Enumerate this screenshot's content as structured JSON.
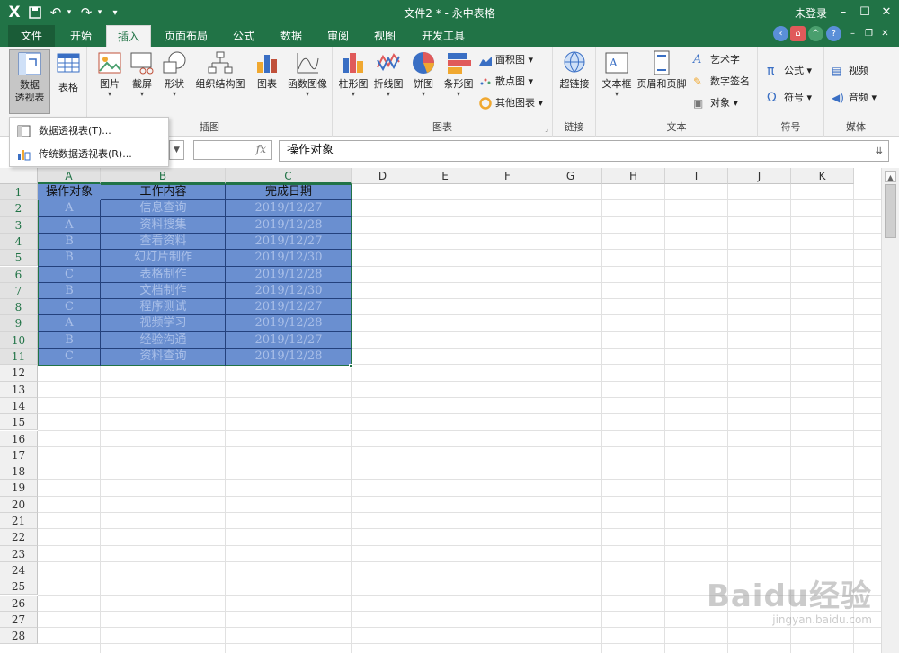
{
  "titlebar": {
    "app_logo": "X",
    "save_icon": "save-icon",
    "undo_icon": "↶",
    "redo_icon": "↷",
    "customize_icon": "▾",
    "title": "文件2 * - 永中表格",
    "login": "未登录",
    "minimize": "–",
    "maximize": "☐",
    "close": "✕"
  },
  "tabs": [
    {
      "label": "文件"
    },
    {
      "label": "开始"
    },
    {
      "label": "插入"
    },
    {
      "label": "页面布局"
    },
    {
      "label": "公式"
    },
    {
      "label": "数据"
    },
    {
      "label": "审阅"
    },
    {
      "label": "视图"
    },
    {
      "label": "开发工具"
    }
  ],
  "active_tab": "插入",
  "ribbon": {
    "pivot_label_1": "数据",
    "pivot_label_2": "透视表",
    "table": "表格",
    "picture": "图片",
    "screenshot": "截屏",
    "shape": "形状",
    "org_chart": "组织结构图",
    "chart": "图表",
    "function_chart": "函数图像",
    "illustrations_group": "插图",
    "column_chart": "柱形图",
    "line_chart": "折线图",
    "pie_chart": "饼图",
    "bar_chart": "条形图",
    "area_chart": "面积图",
    "scatter_chart": "散点图",
    "other_chart": "其他图表",
    "charts_group": "图表",
    "hyperlink": "超链接",
    "links_group": "链接",
    "textbox": "文本框",
    "header_footer": "页眉和页脚",
    "wordart": "艺术字",
    "signature": "数字签名",
    "object": "对象",
    "text_group": "文本",
    "formula": "公式",
    "symbol": "符号",
    "symbols_group": "符号",
    "video": "视频",
    "audio": "音频",
    "media_group": "媒体"
  },
  "menu": {
    "item1": "数据透视表(T)...",
    "item2": "传统数据透视表(R)..."
  },
  "formula_bar": {
    "fx": "fx",
    "content": "操作对象"
  },
  "columns": [
    "A",
    "B",
    "C",
    "D",
    "E",
    "F",
    "G",
    "H",
    "I",
    "J",
    "K"
  ],
  "rows": [
    "1",
    "2",
    "3",
    "4",
    "5",
    "6",
    "7",
    "8",
    "9",
    "10",
    "11",
    "12",
    "13",
    "14",
    "15",
    "16",
    "17",
    "18",
    "19",
    "20",
    "21",
    "22",
    "23",
    "24",
    "25",
    "26",
    "27",
    "28"
  ],
  "table": {
    "headers": [
      "操作对象",
      "工作内容",
      "完成日期"
    ],
    "rows": [
      [
        "A",
        "信息查询",
        "2019/12/27"
      ],
      [
        "A",
        "资料搜集",
        "2019/12/28"
      ],
      [
        "B",
        "查看资料",
        "2019/12/27"
      ],
      [
        "B",
        "幻灯片制作",
        "2019/12/30"
      ],
      [
        "C",
        "表格制作",
        "2019/12/28"
      ],
      [
        "B",
        "文档制作",
        "2019/12/30"
      ],
      [
        "C",
        "程序测试",
        "2019/12/27"
      ],
      [
        "A",
        "视频学习",
        "2019/12/28"
      ],
      [
        "B",
        "经验沟通",
        "2019/12/27"
      ],
      [
        "C",
        "资料查询",
        "2019/12/28"
      ]
    ]
  },
  "watermark": {
    "main": "Baidu经验",
    "sub": "jingyan.baidu.com"
  },
  "colors": {
    "brand": "#217346",
    "selection": "#6a8fd0"
  }
}
